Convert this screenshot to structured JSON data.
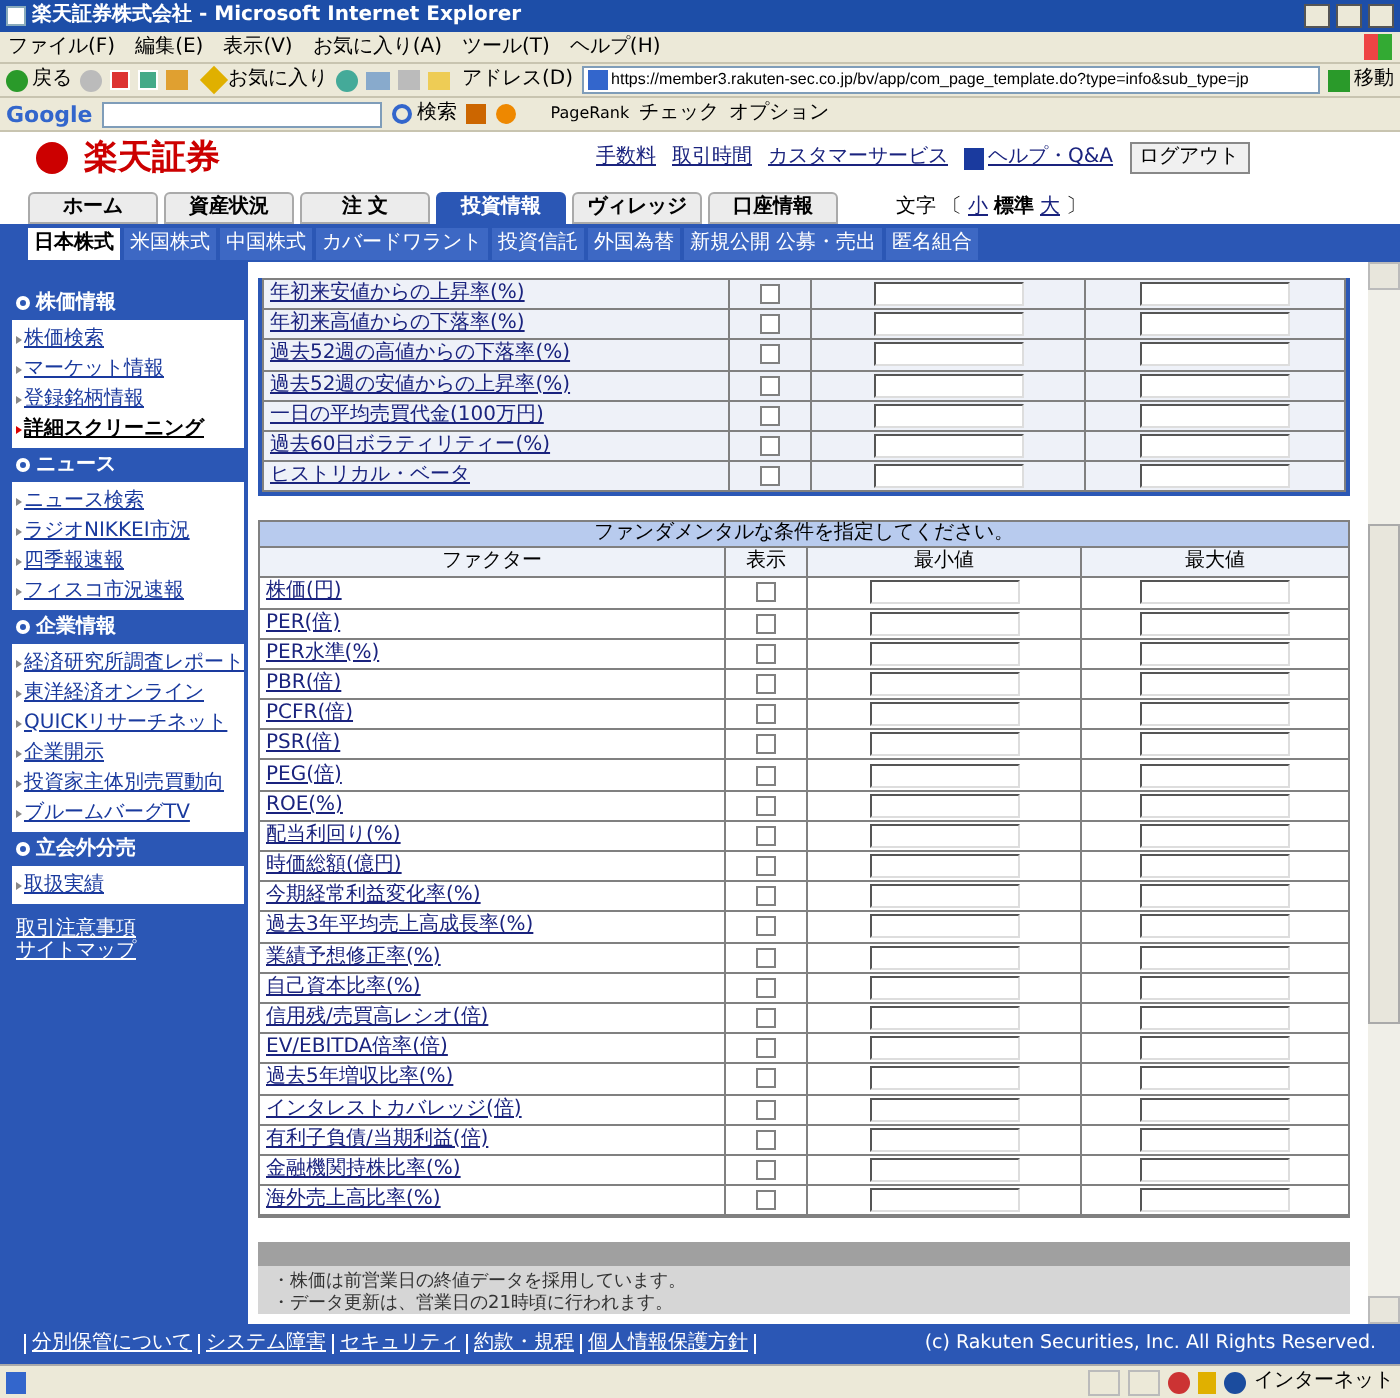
{
  "browser": {
    "title": "楽天証券株式会社 - Microsoft Internet Explorer",
    "menu": [
      "ファイル(F)",
      "編集(E)",
      "表示(V)",
      "お気に入り(A)",
      "ツール(T)",
      "ヘルプ(H)"
    ],
    "back": "戻る",
    "favorites": "お気に入り",
    "address_label": "アドレス(D)",
    "url": "https://member3.rakuten-sec.co.jp/bv/app/com_page_template.do?type=info&sub_type=jp",
    "go": "移動",
    "google": {
      "brand": "Google",
      "search": "検索",
      "pagerank": "PageRank",
      "check": "チェック",
      "options": "オプション"
    }
  },
  "header": {
    "logo": "楽天証券",
    "links": [
      "手数料",
      "取引時間",
      "カスタマーサービス"
    ],
    "help": "ヘルプ・Q&A",
    "logout": "ログアウト"
  },
  "tabs": [
    {
      "label": "ホーム",
      "selected": false
    },
    {
      "label": "資産状況",
      "selected": false
    },
    {
      "label": "注 文",
      "selected": false
    },
    {
      "label": "投資情報",
      "selected": true
    },
    {
      "label": "ヴィレッジ",
      "selected": false
    },
    {
      "label": "口座情報",
      "selected": false
    }
  ],
  "font_size": {
    "label": "文字",
    "open": "〔",
    "close": "〕",
    "options": [
      {
        "label": "小",
        "selected": false
      },
      {
        "label": "標準",
        "selected": true
      },
      {
        "label": "大",
        "selected": false
      }
    ]
  },
  "subtabs": [
    {
      "label": "日本株式",
      "selected": true
    },
    {
      "label": "米国株式",
      "selected": false
    },
    {
      "label": "中国株式",
      "selected": false
    },
    {
      "label": "カバードワラント",
      "selected": false
    },
    {
      "label": "投資信託",
      "selected": false
    },
    {
      "label": "外国為替",
      "selected": false
    },
    {
      "label": "新規公開 公募・売出",
      "selected": false
    },
    {
      "label": "匿名組合",
      "selected": false
    }
  ],
  "sidebar": {
    "sections": [
      {
        "title": "株価情報",
        "items": [
          {
            "label": "株価検索",
            "selected": false
          },
          {
            "label": "マーケット情報",
            "selected": false
          },
          {
            "label": "登録銘柄情報",
            "selected": false
          },
          {
            "label": "詳細スクリーニング",
            "selected": true
          }
        ]
      },
      {
        "title": "ニュース",
        "items": [
          {
            "label": "ニュース検索",
            "selected": false
          },
          {
            "label": "ラジオNIKKEI市況",
            "selected": false
          },
          {
            "label": "四季報速報",
            "selected": false
          },
          {
            "label": "フィスコ市況速報",
            "selected": false
          }
        ]
      },
      {
        "title": "企業情報",
        "items": [
          {
            "label": "経済研究所調査レポート",
            "selected": false
          },
          {
            "label": "東洋経済オンライン",
            "selected": false
          },
          {
            "label": "QUICKリサーチネット",
            "selected": false
          },
          {
            "label": "企業開示",
            "selected": false
          },
          {
            "label": "投資家主体別売買動向",
            "selected": false
          },
          {
            "label": "ブルームバーグTV",
            "selected": false
          }
        ]
      },
      {
        "title": "立会外分売",
        "items": [
          {
            "label": "取扱実績",
            "selected": false
          }
        ]
      }
    ],
    "bottom_links": [
      "取引注意事項",
      "サイトマップ"
    ]
  },
  "technical_table": {
    "rows": [
      {
        "label": "年初来安値からの上昇率(%)",
        "checked": false
      },
      {
        "label": "年初来高値からの下落率(%)",
        "checked": false
      },
      {
        "label": "過去52週の高値からの下落率(%)",
        "checked": false
      },
      {
        "label": "過去52週の安値からの上昇率(%)",
        "checked": false
      },
      {
        "label": "一日の平均売買代金(100万円)",
        "checked": false
      },
      {
        "label": "過去60日ボラティリティー(%)",
        "checked": false
      },
      {
        "label": "ヒストリカル・ベータ",
        "checked": false
      }
    ]
  },
  "fundamental_table": {
    "caption": "ファンダメンタルな条件を指定してください。",
    "columns": [
      "ファクター",
      "表示",
      "最小値",
      "最大値"
    ],
    "rows": [
      {
        "label": "株価(円)",
        "checked": false
      },
      {
        "label": "PER(倍)",
        "checked": false
      },
      {
        "label": "PER水準(%)",
        "checked": false
      },
      {
        "label": "PBR(倍)",
        "checked": false
      },
      {
        "label": "PCFR(倍)",
        "checked": false
      },
      {
        "label": "PSR(倍)",
        "checked": false
      },
      {
        "label": "PEG(倍)",
        "checked": false
      },
      {
        "label": "ROE(%)",
        "checked": false
      },
      {
        "label": "配当利回り(%)",
        "checked": false
      },
      {
        "label": "時価総額(億円)",
        "checked": false
      },
      {
        "label": "今期経常利益変化率(%)",
        "checked": false
      },
      {
        "label": "過去3年平均売上高成長率(%)",
        "checked": false
      },
      {
        "label": "業績予想修正率(%)",
        "checked": false
      },
      {
        "label": "自己資本比率(%)",
        "checked": false
      },
      {
        "label": "信用残/売買高レシオ(倍)",
        "checked": false
      },
      {
        "label": "EV/EBITDA倍率(倍)",
        "checked": false
      },
      {
        "label": "過去5年増収比率(%)",
        "checked": false
      },
      {
        "label": "インタレストカバレッジ(倍)",
        "checked": false
      },
      {
        "label": "有利子負債/当期利益(倍)",
        "checked": false
      },
      {
        "label": "金融機関持株比率(%)",
        "checked": false
      },
      {
        "label": "海外売上高比率(%)",
        "checked": false
      }
    ]
  },
  "notes": [
    "・株価は前営業日の終値データを採用しています。",
    "・データ更新は、営業日の21時頃に行われます。"
  ],
  "footer": {
    "links": [
      "分別保管について",
      "システム障害",
      "セキュリティ",
      "約款・規程",
      "個人情報保護方針"
    ],
    "copyright": "(c) Rakuten Securities, Inc. All Rights Reserved."
  },
  "status_bar": {
    "zone": "インターネット"
  }
}
